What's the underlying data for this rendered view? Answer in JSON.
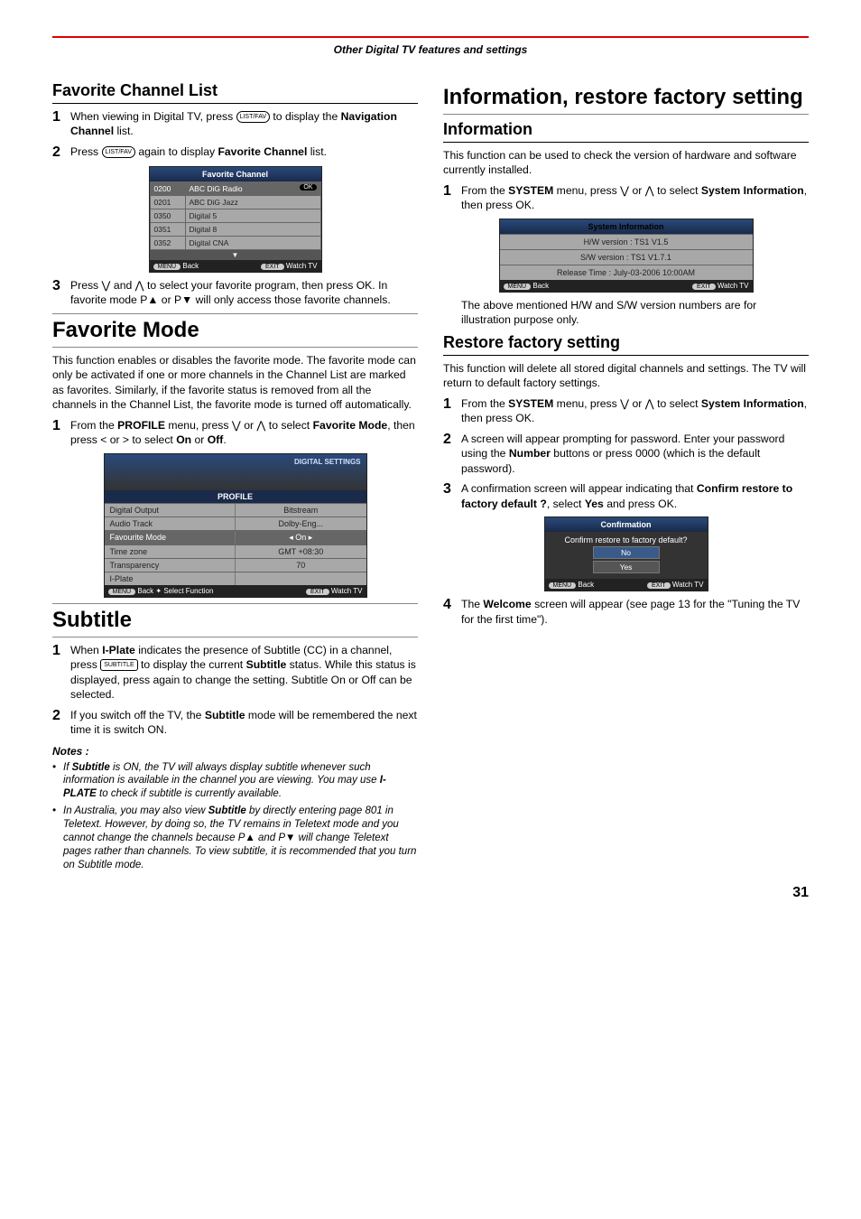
{
  "header": "Other Digital TV features and settings",
  "page_number": "31",
  "left": {
    "h_fav_list": "Favorite Channel List",
    "step1a": "When viewing in Digital TV, press ",
    "step1_icon": "LIST/FAV",
    "step1b": " to display the ",
    "step1_bold": "Navigation Channel",
    "step1c": " list.",
    "step2a": "Press ",
    "step2b": " again to display ",
    "step2_bold": "Favorite Channel",
    "step2c": " list.",
    "fav_osd_title": "Favorite Channel",
    "fav_rows": [
      {
        "num": "0200",
        "name": "ABC DiG Radio",
        "sel": true
      },
      {
        "num": "0201",
        "name": "ABC DiG Jazz"
      },
      {
        "num": "0350",
        "name": "Digital 5"
      },
      {
        "num": "0351",
        "name": "Digital 8"
      },
      {
        "num": "0352",
        "name": "Digital CNA"
      }
    ],
    "footer_menu": "MENU",
    "footer_back": "Back",
    "footer_exit": "EXIT",
    "footer_watch": "Watch TV",
    "step3": "Press ⋁ and ⋀ to select your favorite program, then press OK. In favorite mode P▲ or P▼ will only access those favorite channels.",
    "h_fav_mode": "Favorite Mode",
    "fav_mode_intro": "This function enables or disables the favorite mode. The favorite mode can only be activated if one or more channels in the Channel List are marked as favorites. Similarly, if the favorite status is removed from all the channels in the Channel List, the favorite mode is turned off automatically.",
    "fm_step1a": "From the ",
    "fm_step1_bold1": "PROFILE",
    "fm_step1b": " menu, press ⋁ or ⋀ to select ",
    "fm_step1_bold2": "Favorite Mode",
    "fm_step1c": ", then press < or > to select ",
    "fm_step1_bold3": "On",
    "fm_step1d": " or ",
    "fm_step1_bold4": "Off",
    "fm_step1e": ".",
    "profile_osd_ds": "DIGITAL SETTINGS",
    "profile_header": "PROFILE",
    "profile_rows": [
      {
        "l": "Digital Output",
        "r": "Bitstream"
      },
      {
        "l": "Audio Track",
        "r": "Dolby-Eng..."
      },
      {
        "l": "Favourite Mode",
        "r": "On",
        "sel": true
      },
      {
        "l": "Time zone",
        "r": "GMT +08:30"
      },
      {
        "l": "Transparency",
        "r": "70"
      },
      {
        "l": "I-Plate",
        "r": ""
      }
    ],
    "profile_footer_sel": "Select Function",
    "h_subtitle": "Subtitle",
    "sub_step1a": "When ",
    "sub_step1_b1": "I-Plate",
    "sub_step1b": " indicates the presence of Subtitle (CC) in a channel, press ",
    "sub_step1_icon": "SUBTITLE",
    "sub_step1c": " to display the current ",
    "sub_step1_b2": "Subtitle",
    "sub_step1d": " status. While this status is displayed, press again to change the setting. Subtitle On or Off can be selected.",
    "sub_step2a": "If you switch off the TV, the ",
    "sub_step2_b1": "Subtitle",
    "sub_step2b": " mode will be remembered the next time it is switch ON.",
    "notes_h": "Notes :",
    "note1": "If <b>Subtitle</b> is ON, the TV will always display subtitle whenever such information is available in the channel you are viewing. You may use <b>I-PLATE</b> to check if subtitle is currently available.",
    "note2": "In Australia, you may also view <b>Subtitle</b> by directly entering page 801 in Teletext. However, by doing so, the TV remains in Teletext mode and you cannot change the channels because P▲ and P▼ will change Teletext pages rather than channels.  To view subtitle, it is recommended that you turn on Subtitle mode."
  },
  "right": {
    "h_info_restore": "Information, restore factory setting",
    "h_info": "Information",
    "info_intro": "This function can be used to check the version of hardware and software currently installed.",
    "info_step1a": "From the ",
    "info_step1_b1": "SYSTEM",
    "info_step1b": " menu, press ⋁ or ⋀ to select ",
    "info_step1_b2": "System Information",
    "info_step1c": ", then press OK.",
    "sys_osd_title": "System Information",
    "sys_rows": [
      "H/W version : TS1 V1.5",
      "S/W version : TS1 V1.7.1",
      "Release Time : July-03-2006 10:00AM"
    ],
    "info_after": "The above mentioned H/W and S/W version numbers are for illustration purpose only.",
    "h_restore": "Restore factory setting",
    "restore_intro": "This function will delete all stored digital channels and settings. The TV will return to default factory settings.",
    "r_step1a": "From the ",
    "r_step1_b1": "SYSTEM",
    "r_step1b": " menu, press ⋁ or ⋀ to select ",
    "r_step1_b2": "System Information",
    "r_step1c": ", then press OK.",
    "r_step2a": "A screen will appear prompting for password. Enter your password using the ",
    "r_step2_b1": "Number",
    "r_step2b": " buttons or press 0000 (which is the default password).",
    "r_step3a": "A confirmation screen will appear indicating that ",
    "r_step3_b1": "Confirm restore to factory default ?",
    "r_step3b": ", select ",
    "r_step3_b2": "Yes",
    "r_step3c": " and press OK.",
    "conf_title": "Confirmation",
    "conf_q": "Confirm restore to factory default?",
    "conf_no": "No",
    "conf_yes": "Yes",
    "r_step4a": "The ",
    "r_step4_b1": "Welcome",
    "r_step4b": " screen will appear (see page 13 for the \"Tuning the TV for the first time\")."
  }
}
